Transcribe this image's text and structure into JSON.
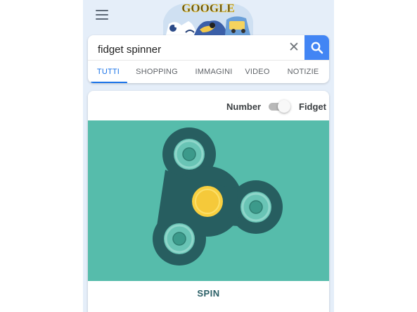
{
  "search": {
    "query": "fidget spinner"
  },
  "tabs": [
    {
      "label": "TUTTI",
      "active": true
    },
    {
      "label": "SHOPPING",
      "active": false
    },
    {
      "label": "IMMAGINI",
      "active": false
    },
    {
      "label": "VIDEO",
      "active": false
    },
    {
      "label": "NOTIZIE",
      "active": false
    }
  ],
  "doodle": {
    "text": "GOOGLE"
  },
  "spinner_widget": {
    "mode_left_label": "Number",
    "mode_right_label": "Fidget",
    "mode": "Fidget",
    "spin_label": "SPIN"
  },
  "colors": {
    "accent": "#4285f4",
    "tab_active": "#1a73e8",
    "stage_bg": "#56bcab",
    "spinner_body": "#275e60",
    "bearing_center": "#f9d03f",
    "spin_label": "#2a5f66"
  }
}
